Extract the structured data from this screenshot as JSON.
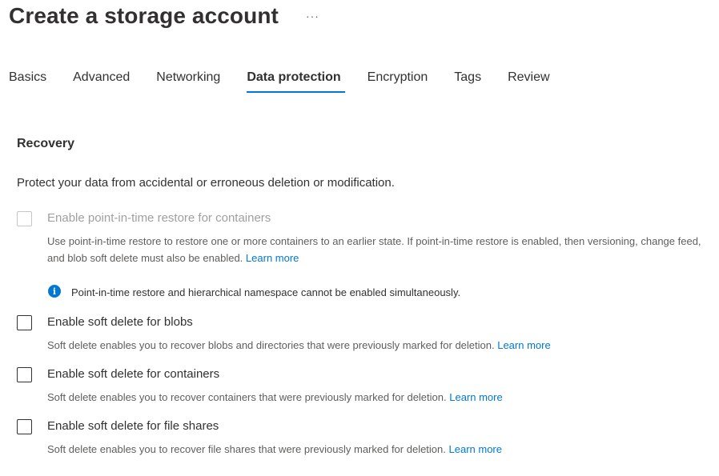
{
  "header": {
    "title": "Create a storage account",
    "more_icon": "ellipsis-icon",
    "more_label": "···"
  },
  "tabs": [
    {
      "label": "Basics"
    },
    {
      "label": "Advanced"
    },
    {
      "label": "Networking"
    },
    {
      "label": "Data protection",
      "active": true
    },
    {
      "label": "Encryption"
    },
    {
      "label": "Tags"
    },
    {
      "label": "Review"
    }
  ],
  "recovery": {
    "heading": "Recovery",
    "description": "Protect your data from accidental or erroneous deletion or modification.",
    "options": [
      {
        "label": "Enable point-in-time restore for containers",
        "description": "Use point-in-time restore to restore one or more containers to an earlier state. If point-in-time restore is enabled, then versioning, change feed, and blob soft delete must also be enabled.",
        "link": "Learn more",
        "checked": false,
        "disabled": true
      },
      {
        "label": "Enable soft delete for blobs",
        "description": "Soft delete enables you to recover blobs and directories that were previously marked for deletion.",
        "link": "Learn more",
        "checked": false,
        "disabled": false
      },
      {
        "label": "Enable soft delete for containers",
        "description": "Soft delete enables you to recover containers that were previously marked for deletion.",
        "link": "Learn more",
        "checked": false,
        "disabled": false
      },
      {
        "label": "Enable soft delete for file shares",
        "description": "Soft delete enables you to recover file shares that were previously marked for deletion.",
        "link": "Learn more",
        "checked": false,
        "disabled": false
      }
    ],
    "info": {
      "icon": "info-icon",
      "icon_glyph": "i",
      "text": "Point-in-time restore and hierarchical namespace cannot be enabled simultaneously."
    }
  },
  "colors": {
    "accent": "#0078d4",
    "text": "#323130",
    "secondary_text": "#605e5c",
    "disabled_text": "#a19f9d"
  }
}
